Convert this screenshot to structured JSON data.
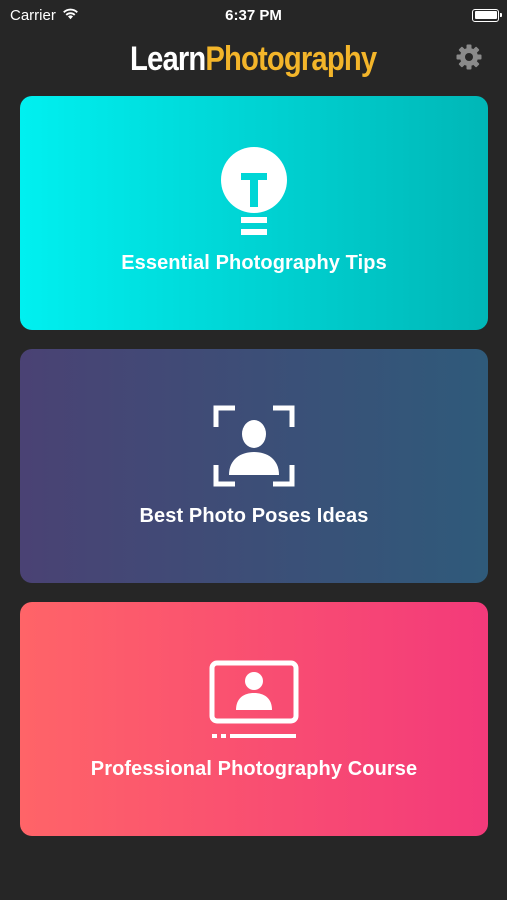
{
  "status_bar": {
    "carrier": "Carrier",
    "time": "6:37 PM",
    "icons": [
      "wifi-icon",
      "battery-icon"
    ]
  },
  "header": {
    "title_part1": "Learn",
    "title_part2": "Photography",
    "title_part1_color": "#ffffff",
    "title_part2_color": "#f3b52a",
    "settings_icon": "gear-icon"
  },
  "cards": [
    {
      "label": "Essential Photography Tips",
      "icon": "lightbulb-icon",
      "gradient": [
        "#00f0f0",
        "#00b7b7"
      ]
    },
    {
      "label": "Best Photo Poses Ideas",
      "icon": "portrait-frame-icon",
      "gradient": [
        "#4a4274",
        "#2f5a7a"
      ]
    },
    {
      "label": "Professional Photography Course",
      "icon": "video-course-icon",
      "gradient": [
        "#ff6468",
        "#f33a7a"
      ]
    }
  ],
  "colors": {
    "background": "#262626",
    "accent": "#f3b52a"
  }
}
